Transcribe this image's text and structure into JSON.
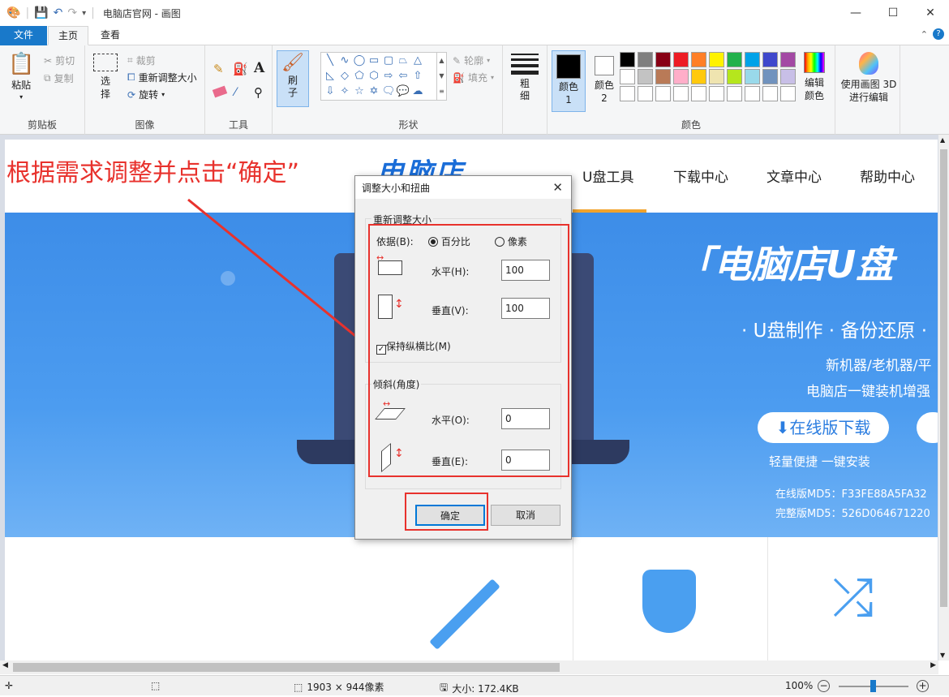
{
  "window": {
    "title": "电脑店官网 - 画图"
  },
  "tabs": {
    "file": "文件",
    "home": "主页",
    "view": "查看"
  },
  "ribbon": {
    "clipboard": {
      "paste": "粘贴",
      "cut": "剪切",
      "copy": "复制",
      "group": "剪贴板"
    },
    "image": {
      "select": "选择",
      "crop": "裁剪",
      "resize": "重新调整大小",
      "rotate": "旋转",
      "group": "图像"
    },
    "tools": {
      "group": "工具"
    },
    "brush": {
      "label": "刷子"
    },
    "shapes": {
      "outline": "轮廓",
      "fill": "填充",
      "group": "形状"
    },
    "size": {
      "label": "粗细"
    },
    "colors": {
      "color1": "颜色 1",
      "color2": "颜色 2",
      "edit": "编辑颜色",
      "group": "颜色",
      "paint3d": "使用画图 3D 进行编辑",
      "palette": [
        "#000000",
        "#7f7f7f",
        "#880015",
        "#ed1c24",
        "#ff7f27",
        "#fff200",
        "#22b14c",
        "#00a2e8",
        "#3f48cc",
        "#a349a4",
        "#ffffff",
        "#c3c3c3",
        "#b97a57",
        "#ffaec9",
        "#ffc90e",
        "#efe4b0",
        "#b5e61d",
        "#99d9ea",
        "#7092be",
        "#c8bfe7"
      ]
    }
  },
  "website": {
    "nav": [
      "U盘工具",
      "下载中心",
      "文章中心",
      "帮助中心"
    ],
    "logo": "电脑店",
    "banner_title": "「电脑店U盘",
    "banner_line1": "· U盘制作 · 备份还原 ·",
    "banner_line2": "新机器/老机器/平",
    "banner_line3": "电脑店一键装机增强",
    "download_btn": "⬇在线版下载",
    "caption": "轻量便捷 一键安装",
    "md5_online": "在线版MD5：F33FE88A5FA32",
    "md5_full": "完整版MD5：526D064671220"
  },
  "annotation": "根据需求调整并点击“确定”",
  "dialog": {
    "title": "调整大小和扭曲",
    "resize_legend": "重新调整大小",
    "by_label": "依据(B):",
    "percent": "百分比",
    "pixels": "像素",
    "horizontal_label": "水平(H):",
    "horizontal_value": "100",
    "vertical_label": "垂直(V):",
    "vertical_value": "100",
    "keep_ratio": "保持纵横比(M)",
    "skew_legend": "倾斜(角度)",
    "skew_h_label": "水平(O):",
    "skew_h_value": "0",
    "skew_v_label": "垂直(E):",
    "skew_v_value": "0",
    "ok": "确定",
    "cancel": "取消"
  },
  "status": {
    "dimensions": "1903 × 944像素",
    "size": "大小: 172.4KB",
    "zoom": "100%"
  }
}
